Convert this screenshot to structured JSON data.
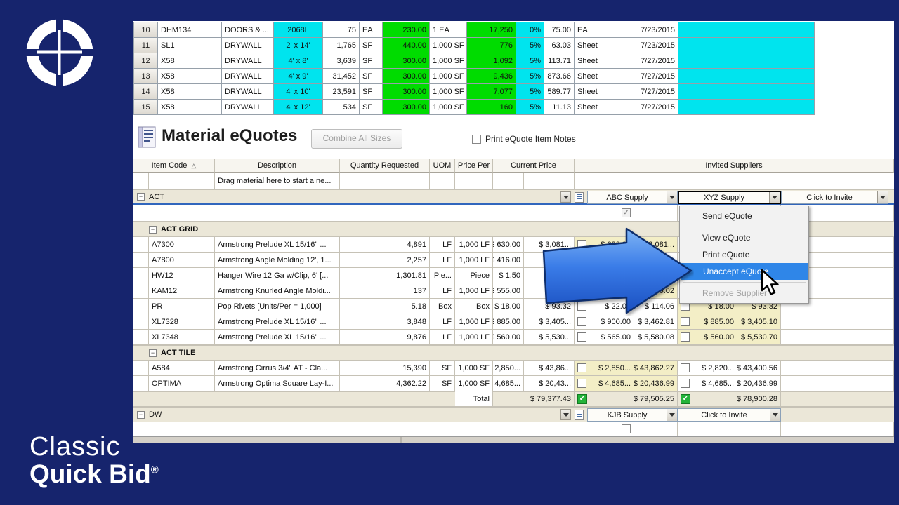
{
  "branding": {
    "line1": "Classic",
    "line2": "Quick Bid",
    "reg": "®"
  },
  "top_grid": {
    "rows": [
      {
        "num": "10",
        "code": "DHM134",
        "cat": "DOORS & ...",
        "size": "2068L",
        "qty": "75",
        "uom": "EA",
        "val1": "230.00",
        "per": "1 EA",
        "val2": "17,250",
        "pct": "0%",
        "price": "75.00",
        "unit": "EA",
        "date": "7/23/2015"
      },
      {
        "num": "11",
        "code": "SL1",
        "cat": "DRYWALL",
        "size": "2' x 14'",
        "qty": "1,765",
        "uom": "SF",
        "val1": "440.00",
        "per": "1,000 SF",
        "val2": "776",
        "pct": "5%",
        "price": "63.03",
        "unit": "Sheet",
        "date": "7/23/2015"
      },
      {
        "num": "12",
        "code": "X58",
        "cat": "DRYWALL",
        "size": "4' x 8'",
        "qty": "3,639",
        "uom": "SF",
        "val1": "300.00",
        "per": "1,000 SF",
        "val2": "1,092",
        "pct": "5%",
        "price": "113.71",
        "unit": "Sheet",
        "date": "7/27/2015"
      },
      {
        "num": "13",
        "code": "X58",
        "cat": "DRYWALL",
        "size": "4' x 9'",
        "qty": "31,452",
        "uom": "SF",
        "val1": "300.00",
        "per": "1,000 SF",
        "val2": "9,436",
        "pct": "5%",
        "price": "873.66",
        "unit": "Sheet",
        "date": "7/27/2015"
      },
      {
        "num": "14",
        "code": "X58",
        "cat": "DRYWALL",
        "size": "4' x 10'",
        "qty": "23,591",
        "uom": "SF",
        "val1": "300.00",
        "per": "1,000 SF",
        "val2": "7,077",
        "pct": "5%",
        "price": "589.77",
        "unit": "Sheet",
        "date": "7/27/2015"
      },
      {
        "num": "15",
        "code": "X58",
        "cat": "DRYWALL",
        "size": "4' x 12'",
        "qty": "534",
        "uom": "SF",
        "val1": "300.00",
        "per": "1,000 SF",
        "val2": "160",
        "pct": "5%",
        "price": "11.13",
        "unit": "Sheet",
        "date": "7/27/2015"
      }
    ]
  },
  "section": {
    "title": "Material eQuotes",
    "combine_button_label": "Combine All Sizes",
    "print_checkbox_label": "Print eQuote Item Notes",
    "print_checkbox_checked": false
  },
  "grid": {
    "headers": {
      "item_code": "Item Code",
      "description": "Description",
      "quantity_requested": "Quantity Requested",
      "uom": "UOM",
      "price_per": "Price Per",
      "current_price": "Current Price",
      "invited_suppliers": "Invited Suppliers"
    },
    "drag_hint": "Drag material here to start a ne...",
    "act_group": {
      "label": "ACT",
      "suppliers": [
        {
          "name": "ABC Supply",
          "focused": false
        },
        {
          "name": "XYZ Supply",
          "focused": true
        },
        {
          "name": "Click to Invite",
          "focused": false
        }
      ],
      "abc_checkbox_checked": true
    },
    "subgroups": [
      {
        "label": "ACT GRID",
        "items": [
          {
            "code": "A7300",
            "desc": "Armstrong Prelude XL 15/16\" ...",
            "qty": "4,891",
            "uom": "LF",
            "per": "1,000 LF",
            "cur_u": "$ 630.00",
            "cur_x": "$ 3,081...",
            "abc_u": "$ 630.00",
            "abc_x": "$ 3,081...",
            "abc_accepted": true,
            "xyz_u": null,
            "xyz_x": null,
            "xyz_accepted": false
          },
          {
            "code": "A7800",
            "desc": "Armstrong Angle Molding 12', 1...",
            "qty": "2,257",
            "uom": "LF",
            "per": "1,000 LF",
            "cur_u": "$ 416.00",
            "cur_x": "$ 9",
            "abc_u": null,
            "abc_x": null,
            "abc_accepted": false,
            "xyz_u": null,
            "xyz_x": null,
            "xyz_accepted": false
          },
          {
            "code": "HW12",
            "desc": "Hanger Wire 12 Ga w/Clip, 6' [...",
            "qty": "1,301.81",
            "uom": "Pie...",
            "per": "Piece",
            "cur_u": "$ 1.50",
            "cur_x": "$ 1",
            "abc_u": null,
            "abc_x": null,
            "abc_accepted": false,
            "xyz_u": null,
            "xyz_x": null,
            "xyz_accepted": false
          },
          {
            "code": "KAM12",
            "desc": "Armstrong Knurled Angle Moldi...",
            "qty": "137",
            "uom": "LF",
            "per": "1,000 LF",
            "cur_u": "$ 555.00",
            "cur_x": "$ 76.02",
            "abc_u": "$ 555.00",
            "abc_x": "$ 76.02",
            "abc_accepted": true,
            "xyz_u": null,
            "xyz_x": null,
            "xyz_accepted": false
          },
          {
            "code": "PR",
            "desc": "Pop Rivets [Units/Per = 1,000]",
            "qty": "5.18",
            "uom": "Box",
            "per": "Box",
            "cur_u": "$ 18.00",
            "cur_x": "$ 93.32",
            "abc_u": "$ 22.00",
            "abc_x": "$ 114.06",
            "abc_accepted": false,
            "xyz_u": "$ 18.00",
            "xyz_x": "$ 93.32",
            "xyz_accepted": true
          },
          {
            "code": "XL7328",
            "desc": "Armstrong Prelude XL 15/16\" ...",
            "qty": "3,848",
            "uom": "LF",
            "per": "1,000 LF",
            "cur_u": "$ 885.00",
            "cur_x": "$ 3,405...",
            "abc_u": "$ 900.00",
            "abc_x": "$ 3,462.81",
            "abc_accepted": false,
            "xyz_u": "$ 885.00",
            "xyz_x": "$ 3,405.10",
            "xyz_accepted": true
          },
          {
            "code": "XL7348",
            "desc": "Armstrong Prelude XL 15/16\" ...",
            "qty": "9,876",
            "uom": "LF",
            "per": "1,000 LF",
            "cur_u": "$ 560.00",
            "cur_x": "$ 5,530...",
            "abc_u": "$ 565.00",
            "abc_x": "$ 5,580.08",
            "abc_accepted": false,
            "xyz_u": "$ 560.00",
            "xyz_x": "$ 5,530.70",
            "xyz_accepted": true
          }
        ]
      },
      {
        "label": "ACT TILE",
        "items": [
          {
            "code": "A584",
            "desc": "Armstrong Cirrus 3/4\" AT - Cla...",
            "qty": "15,390",
            "uom": "SF",
            "per": "1,000 SF",
            "cur_u": "$ 2,850...",
            "cur_x": "$ 43,86...",
            "abc_u": "$ 2,850...",
            "abc_x": "$ 43,862.27",
            "abc_accepted": true,
            "xyz_u": "$ 2,820...",
            "xyz_x": "$ 43,400.56",
            "xyz_accepted": false
          },
          {
            "code": "OPTIMA",
            "desc": "Armstrong Optima Square Lay-I...",
            "qty": "4,362.22",
            "uom": "SF",
            "per": "1,000 SF",
            "cur_u": "$ 4,685...",
            "cur_x": "$ 20,43...",
            "abc_u": "$ 4,685...",
            "abc_x": "$ 20,436.99",
            "abc_accepted": true,
            "xyz_u": "$ 4,685...",
            "xyz_x": "$ 20,436.99",
            "xyz_accepted": false
          }
        ]
      }
    ],
    "total": {
      "label": "Total",
      "current": "$ 79,377.43",
      "abc": "$ 79,505.25",
      "xyz": "$ 78,900.28"
    },
    "dw_group": {
      "label": "DW",
      "suppliers": [
        {
          "name": "KJB Supply",
          "focused": false
        },
        {
          "name": "Click to Invite",
          "focused": false
        }
      ],
      "kjb_checkbox_checked": false
    }
  },
  "context_menu": {
    "items": [
      {
        "label": "Send eQuote",
        "highlighted": false,
        "disabled": false,
        "sep_after": true
      },
      {
        "label": "View eQuote",
        "highlighted": false,
        "disabled": false,
        "sep_after": false
      },
      {
        "label": "Print eQuote",
        "highlighted": false,
        "disabled": false,
        "sep_after": false
      },
      {
        "label": "Unaccept eQuote",
        "highlighted": true,
        "disabled": false,
        "sep_after": true
      },
      {
        "label": "Remove Supplier",
        "highlighted": false,
        "disabled": true,
        "sep_after": false
      }
    ]
  },
  "colors": {
    "navy": "#16246d",
    "cyan": "#00e4ee",
    "green": "#00dc00",
    "accepted_yellow": "#f3eec6",
    "menu_highlight": "#2f86e8",
    "group_beige": "#ebe7d8"
  }
}
